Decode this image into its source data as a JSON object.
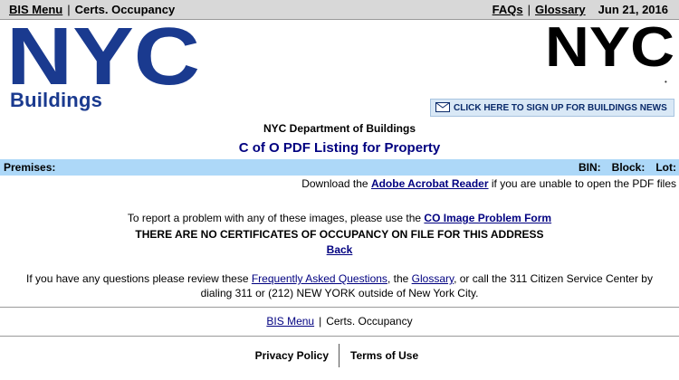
{
  "topbar": {
    "bis_menu": "BIS Menu",
    "separator": "|",
    "section": "Certs. Occupancy",
    "faqs": "FAQs",
    "glossary": "Glossary",
    "date": "Jun 21, 2016"
  },
  "logo": {
    "primary_letters": "NYC",
    "subtitle": "Buildings",
    "secondary_letters": "NYC"
  },
  "signup": {
    "label": "CLICK HERE TO SIGN UP FOR BUILDINGS NEWS",
    "icon": "envelope-icon"
  },
  "header": {
    "department": "NYC Department of Buildings",
    "title": "C of O PDF Listing for Property"
  },
  "premises_bar": {
    "premises": "Premises:",
    "bin": "BIN:",
    "block": "Block:",
    "lot": "Lot:"
  },
  "download": {
    "prefix": "Download the",
    "link": "Adobe Acrobat Reader",
    "suffix": "if you are unable to open the PDF files"
  },
  "report": {
    "prefix": "To report a problem with any of these images, please use the",
    "link": "CO Image Problem Form"
  },
  "no_certificates": "THERE ARE NO CERTIFICATES OF OCCUPANCY ON FILE FOR THIS ADDRESS",
  "back_link": "Back",
  "questions": {
    "part1": "If you have any questions please review these",
    "faq_link": "Frequently Asked Questions",
    "part2": ", the",
    "glossary_link": "Glossary",
    "part3": ", or call the 311 Citizen Service Center by",
    "line2": "dialing 311 or (212) NEW YORK outside of New York City."
  },
  "bottom_nav": {
    "bis_menu": "BIS Menu",
    "separator": "|",
    "section": "Certs. Occupancy"
  },
  "footer": {
    "privacy": "Privacy Policy",
    "terms": "Terms of Use"
  },
  "colors": {
    "link": "#000080",
    "premises_bar": "#add8f8",
    "logo_blue": "#1a3a8f",
    "topbar": "#d8d8d8"
  }
}
